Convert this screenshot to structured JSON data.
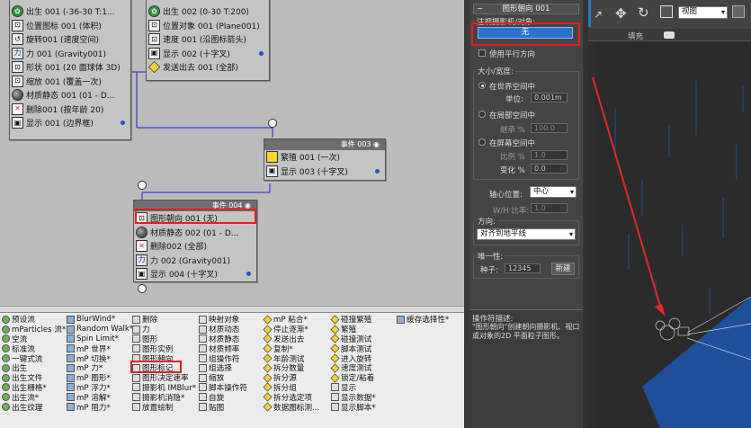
{
  "nodes": {
    "event1": {
      "rows": [
        {
          "icon": "✿",
          "label": "出生 001 (-36-30 T:1..."
        },
        {
          "icon": "⊡",
          "label": "位置图标 001 (体积)"
        },
        {
          "icon": "↺",
          "label": "旋转001 (速度空间)"
        },
        {
          "icon": "力",
          "label": "力 001 (Gravity001)"
        },
        {
          "icon": "⊡",
          "label": "形状 001 (20 面球体 3D)"
        },
        {
          "icon": "⊡",
          "label": "缩放 001 (覆盖一次)"
        },
        {
          "icon": "",
          "label": "材质静态 001 (01 - D..."
        },
        {
          "icon": "✕",
          "label": "删除001 (按年龄 20)"
        },
        {
          "icon": "▣",
          "label": "显示 001 (边界框)"
        }
      ]
    },
    "event2": {
      "rows": [
        {
          "icon": "✿",
          "label": "出生 002 (0-30 T:200)"
        },
        {
          "icon": "⊡",
          "label": "位置对象 001 (Plane001)"
        },
        {
          "icon": "⊡",
          "label": "速度 001 (沿图标箭头)"
        },
        {
          "icon": "▣",
          "label": "显示 002 (十字叉)"
        },
        {
          "icon": "",
          "label": "发送出去 001 (全部)"
        }
      ]
    },
    "event3": {
      "title": "事件 003",
      "rows": [
        {
          "icon": "",
          "label": "繁殖 001 (一次)"
        },
        {
          "icon": "▣",
          "label": "显示 003 (十字叉)"
        }
      ]
    },
    "event4": {
      "title": "事件 004",
      "rows": [
        {
          "icon": "⊡",
          "label": "图形朝向 001 (无)"
        },
        {
          "icon": "",
          "label": "材质静态 002 (01 - D..."
        },
        {
          "icon": "✕",
          "label": "删除002 (全部)"
        },
        {
          "icon": "力",
          "label": "力 002 (Gravity001)"
        },
        {
          "icon": "▣",
          "label": "显示 004 (十字叉)"
        }
      ]
    }
  },
  "depot": {
    "col1": [
      "预设流",
      "mParticles 流*",
      "空流",
      "标准流",
      "一键式流",
      "出生",
      "出生文件",
      "出生栅格*",
      "出生流*",
      "出生纹理"
    ],
    "col2": [
      "BlurWind*",
      "Random Walk*",
      "Spin Limit*",
      "mP 世界*",
      "mP 切换*",
      "mP 力*",
      "mP 图形*",
      "mP 浮力*",
      "mP 溶解*",
      "mP 阻力*"
    ],
    "col3": [
      "删除",
      "力",
      "图形",
      "图形实例",
      "图形朝向",
      "图形标记",
      "图形决定速率",
      "摄影机 IMBlur*",
      "摄影机消隐*",
      "放置绘制"
    ],
    "col4": [
      "映射对象",
      "材质动态",
      "材质静态",
      "材质频率",
      "组操作符",
      "组选择",
      "缩放",
      "脚本操作符",
      "自旋",
      "贴图"
    ],
    "col5": [
      "mP 粘合*",
      "停止逐渐*",
      "发送出去",
      "复制*",
      "年龄测试",
      "拆分数量",
      "拆分源",
      "拆分组",
      "拆分选定项",
      "数据图标测..."
    ],
    "col6": [
      "碰撞繁殖",
      "繁殖",
      "碰撞测试",
      "脚本测试",
      "进入旋转",
      "速度测试",
      "锁定/粘着",
      "显示",
      "显示数据*",
      "显示脚本*"
    ],
    "col7": [
      "缓存选择性*"
    ]
  },
  "panel": {
    "title": "图形朝向 001",
    "look_at_label": "注视摄影机/对象:",
    "none_button": "无",
    "use_parallel": "使用平行方向",
    "size_group": "大小/宽度:",
    "world_space": "在世界空间中",
    "units_label": "单位:",
    "units_value": "0.001m",
    "local_space": "在局部空间中",
    "inherit_label": "继承 %",
    "inherit_value": "100.0",
    "screen_space": "在屏幕空间中",
    "ratio_label": "比例 %",
    "ratio_value": "1.0",
    "variation_label": "变化 %",
    "variation_value": "0.0",
    "pivot_label": "轴心位置:",
    "pivot_value": "中心",
    "wh_label": "W/H 比率:",
    "wh_value": "1.0",
    "direction_group": "方向:",
    "direction_value": "对齐到地平线",
    "uniqueness_group": "唯一性:",
    "seed_label": "种子:",
    "seed_value": "12345",
    "new_button": "新建",
    "desc_label": "操作符描述:",
    "desc_text": "\"图形朝向\"创建朝向摄影机、视口或对象的2D 平面粒子图形。"
  },
  "viewport": {
    "view_select": "视图",
    "tab_fill": "填充"
  }
}
